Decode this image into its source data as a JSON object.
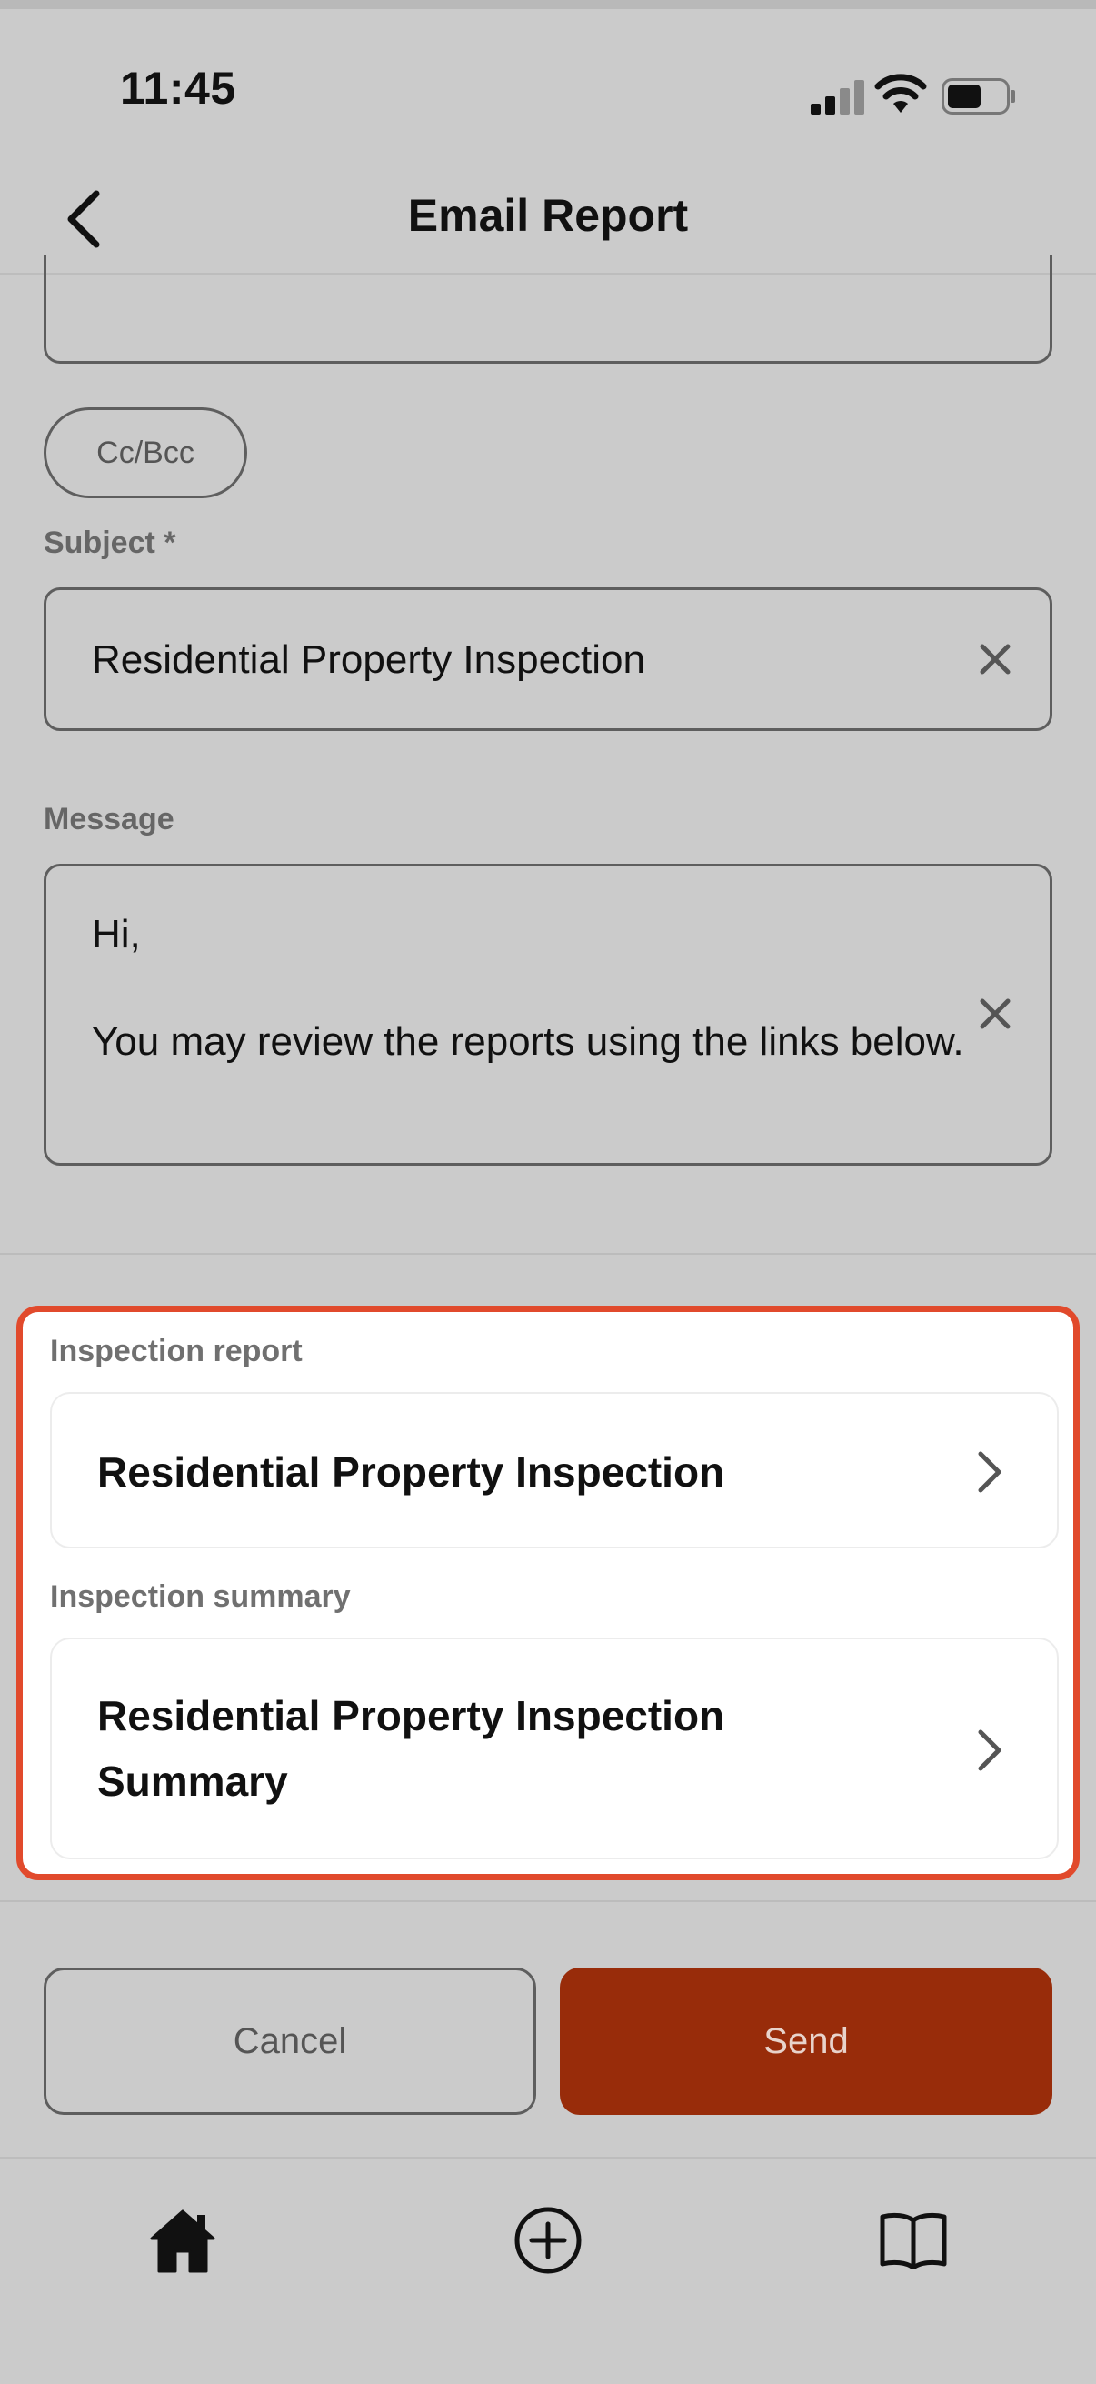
{
  "status_bar": {
    "time": "11:45"
  },
  "nav": {
    "title": "Email Report",
    "back_icon": "chevron-left-icon"
  },
  "form": {
    "cc_bcc_label": "Cc/Bcc",
    "subject_label": "Subject *",
    "subject_value": "Residential Property Inspection",
    "message_label": "Message",
    "message_line1": "Hi,",
    "message_line2": "You may review the reports using the links below."
  },
  "attachments": {
    "report_label": "Inspection report",
    "report_title": "Residential Property Inspection",
    "summary_label": "Inspection summary",
    "summary_title_line1": "Residential Property Inspection",
    "summary_title_line2": "Summary"
  },
  "actions": {
    "cancel_label": "Cancel",
    "send_label": "Send"
  },
  "tabbar": {
    "items": [
      "home-icon",
      "add-circle-icon",
      "book-icon"
    ]
  },
  "colors": {
    "accent": "#982c0a",
    "highlight_border": "#e14a2c",
    "background": "#cbcbcb"
  }
}
